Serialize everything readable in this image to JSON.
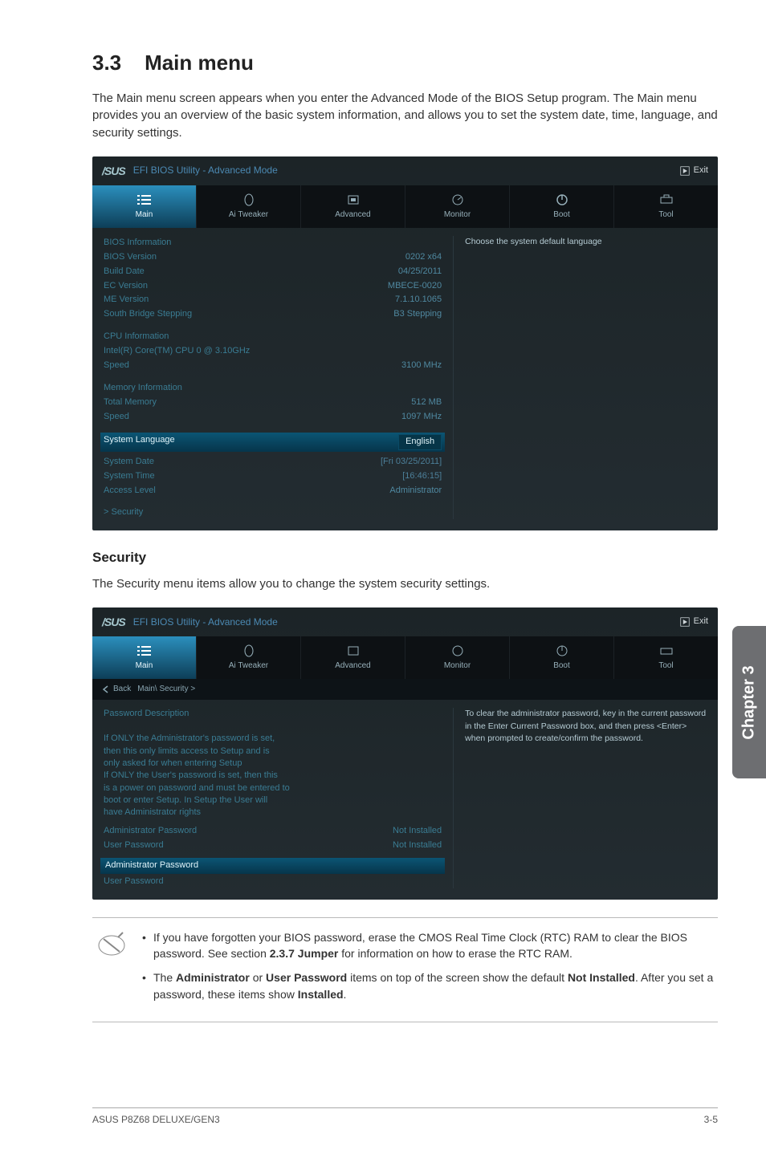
{
  "section": {
    "number": "3.3",
    "title": "Main menu"
  },
  "intro": "The Main menu screen appears when you enter the Advanced Mode of the BIOS Setup program. The Main menu provides you an overview of the basic system information, and allows you to set the system date, time, language, and security settings.",
  "bios1": {
    "brand": "/SUS",
    "title": "EFI BIOS Utility - Advanced Mode",
    "exit": "Exit",
    "tabs": [
      "Main",
      "Ai Tweaker",
      "Advanced",
      "Monitor",
      "Boot",
      "Tool"
    ],
    "help": "Choose the system default language",
    "groups": {
      "bios_info_title": "BIOS Information",
      "bios_version_label": "BIOS Version",
      "bios_version_val": "0202 x64",
      "build_date_label": "Build Date",
      "build_date_val": "04/25/2011",
      "ec_version_label": "EC Version",
      "ec_version_val": "MBECE-0020",
      "me_version_label": "ME Version",
      "me_version_val": "7.1.10.1065",
      "sb_step_label": "South Bridge Stepping",
      "sb_step_val": "B3 Stepping",
      "cpu_info_title": "CPU Information",
      "cpu_model": "Intel(R) Core(TM) CPU 0 @ 3.10GHz",
      "cpu_speed_label": "Speed",
      "cpu_speed_val": "3100 MHz",
      "mem_info_title": "Memory Information",
      "total_mem_label": "Total Memory",
      "total_mem_val": "512 MB",
      "mem_speed_label": "Speed",
      "mem_speed_val": "1097 MHz",
      "sys_lang_label": "System Language",
      "sys_lang_val": "English",
      "sys_date_label": "System Date",
      "sys_date_val": "[Fri 03/25/2011]",
      "sys_time_label": "System Time",
      "sys_time_val": "[16:46:15]",
      "access_label": "Access Level",
      "access_val": "Administrator",
      "security_link": "Security"
    }
  },
  "security_heading": "Security",
  "security_intro": "The Security menu items allow you to change the system security settings.",
  "bios2": {
    "back": "Back",
    "crumb": "Main\\ Security >",
    "help1": "To clear the administrator password, key in the current password in the Enter Current Password box, and then press <Enter> when prompted to create/confirm the password.",
    "pw_desc_title": "Password Description",
    "pw_desc_lines": [
      "If ONLY the Administrator's password is set,",
      "then this only limits access to Setup and is",
      "only asked for when entering Setup",
      "If ONLY the User's password is set, then this",
      "is a power on password and must be entered to",
      "boot or enter Setup. In Setup the User will",
      "have Administrator rights"
    ],
    "admin_pw_label": "Administrator Password",
    "admin_pw_val": "Not Installed",
    "user_pw_label": "User Password",
    "user_pw_val": "Not Installed",
    "sel_admin": "Administrator Password",
    "sel_user": "User Password"
  },
  "notes": {
    "n1a": "If you have forgotten your BIOS password, erase the CMOS Real Time Clock (RTC) RAM to clear the BIOS password. See section ",
    "n1b": "2.3.7 Jumper",
    "n1c": " for information on how to erase the RTC RAM.",
    "n2a": "The ",
    "n2b": "Administrator",
    "n2c": " or ",
    "n2d": "User Password",
    "n2e": " items on top of the screen show the default ",
    "n2f": "Not Installed",
    "n2g": ". After you set a password, these items show ",
    "n2h": "Installed",
    "n2i": "."
  },
  "footer": {
    "left": "ASUS P8Z68 DELUXE/GEN3",
    "right": "3-5"
  },
  "chapter_tab": "Chapter 3"
}
